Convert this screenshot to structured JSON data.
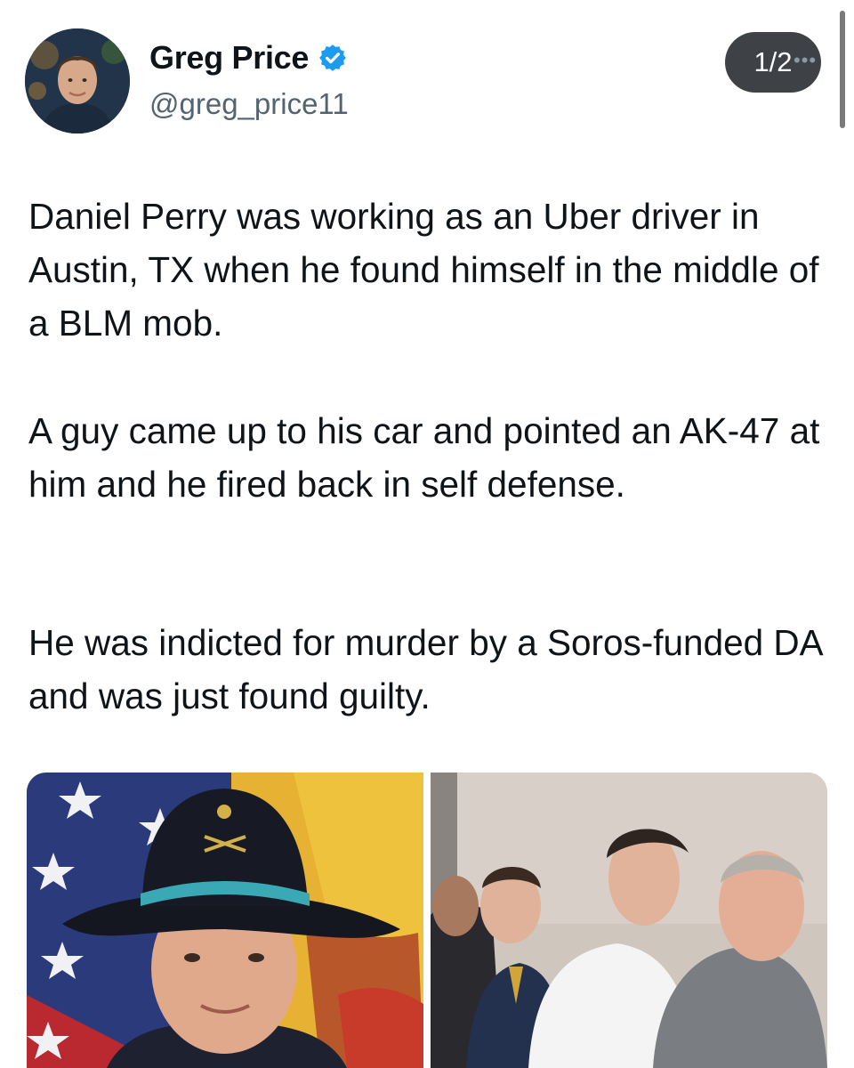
{
  "author": {
    "display_name": "Greg Price",
    "handle": "@greg_price11",
    "verified": true,
    "avatar_icon": "profile-photo"
  },
  "pagination": "1/2",
  "tweet": {
    "paragraphs": [
      "Daniel Perry was working as an Uber driver in Austin, TX when he found himself in the middle of a BLM mob.",
      "A guy came up to his car and pointed an AK-47 at him and he fired back in self defense.",
      "He was indicted for murder by a Soros-funded DA and was just found guilty."
    ]
  },
  "media": [
    {
      "icon": "portrait-photo-cavalry-hat"
    },
    {
      "icon": "courtroom-photo"
    }
  ],
  "colors": {
    "verified": "#1d9bf0",
    "text": "#0f1419",
    "secondary_text": "#536471",
    "pill_bg": "#3e4246"
  }
}
